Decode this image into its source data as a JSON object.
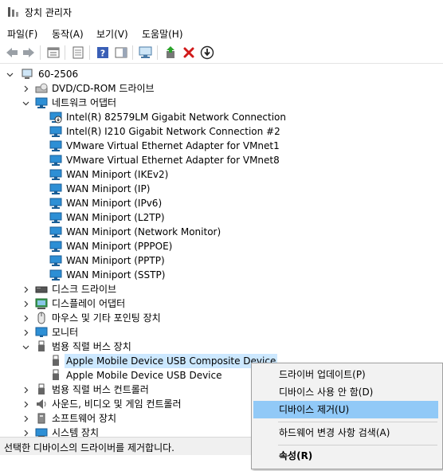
{
  "window": {
    "title": "장치 관리자"
  },
  "menu": [
    "파일(F)",
    "동작(A)",
    "보기(V)",
    "도움말(H)"
  ],
  "toolbar": [
    "back-icon",
    "forward-icon",
    "properties-icon",
    "help-icon",
    "update-driver-icon",
    "scan-hardware-icon",
    "enable-device-icon",
    "uninstall-icon",
    "disable-device-icon"
  ],
  "tree": {
    "root": "60-2506",
    "nodes": {
      "dvd": "DVD/CD-ROM 드라이브",
      "network": "네트워크 어댑터",
      "net_items": [
        "Intel(R) 82579LM Gigabit Network Connection",
        "Intel(R) I210 Gigabit Network Connection #2",
        "VMware Virtual Ethernet Adapter for VMnet1",
        "VMware Virtual Ethernet Adapter for VMnet8",
        "WAN Miniport (IKEv2)",
        "WAN Miniport (IP)",
        "WAN Miniport (IPv6)",
        "WAN Miniport (L2TP)",
        "WAN Miniport (Network Monitor)",
        "WAN Miniport (PPPOE)",
        "WAN Miniport (PPTP)",
        "WAN Miniport (SSTP)"
      ],
      "disk": "디스크 드라이브",
      "display": "디스플레이 어댑터",
      "mouse": "마우스 및 기타 포인팅 장치",
      "monitor": "모니터",
      "usb_devices": "범용 직렬 버스 장치",
      "usb_items": [
        "Apple Mobile Device USB Composite Device",
        "Apple Mobile Device USB Device"
      ],
      "usb_controllers": "범용 직렬 버스 컨트롤러",
      "sound": "사운드, 비디오 및 게임 컨트롤러",
      "software": "소프트웨어 장치",
      "system": "시스템 장치"
    }
  },
  "status": "선택한 디바이스의 드라이버를 제거합니다.",
  "context_menu": {
    "items": [
      "드라이버 업데이트(P)",
      "디바이스 사용 안 함(D)",
      "디바이스 제거(U)",
      "하드웨어 변경 사항 검색(A)",
      "속성(R)"
    ],
    "highlighted": "디바이스 제거(U)"
  },
  "colors": {
    "highlight": "#91c9f7",
    "selection": "#cce8ff",
    "netIcon": "#2d8fd5",
    "uninstall": "#d11a1a"
  }
}
